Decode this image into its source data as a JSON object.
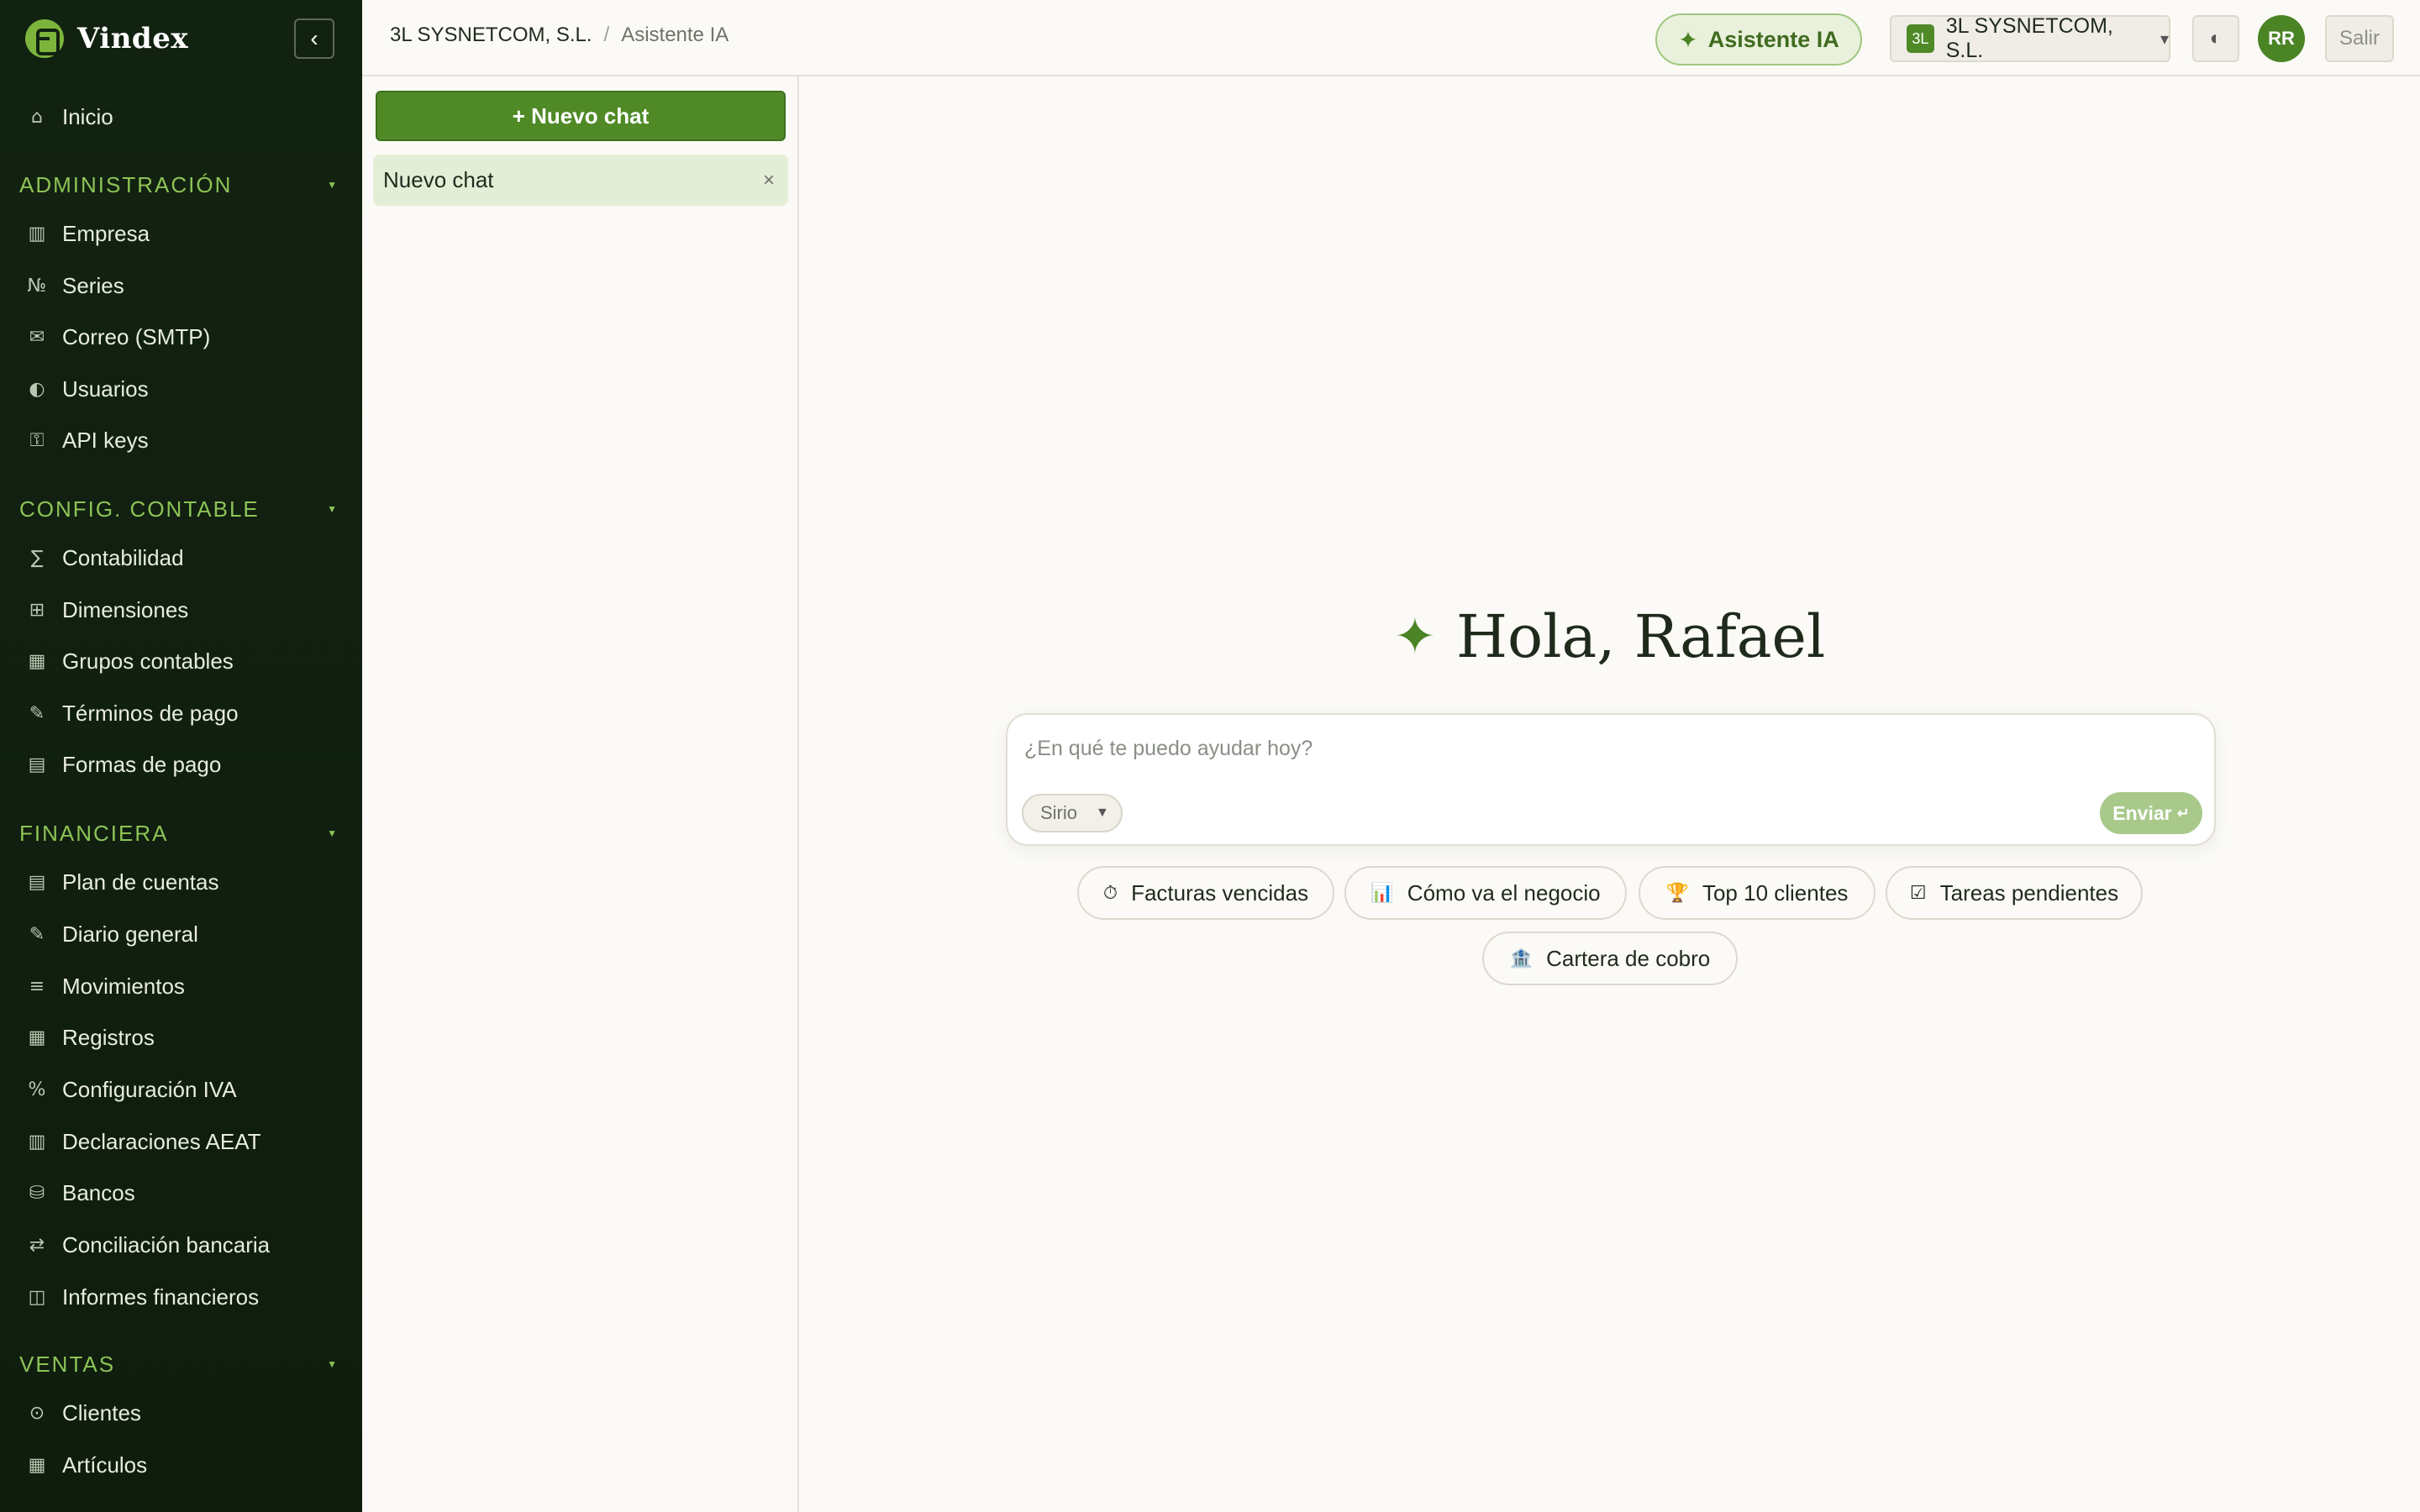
{
  "brand": {
    "name": "Vindex",
    "collapse_icon": "‹"
  },
  "sidebar": {
    "home": {
      "icon": "⌂",
      "label": "Inicio"
    },
    "sections": [
      {
        "title": "ADMINISTRACIÓN",
        "items": [
          {
            "icon": "▥",
            "label": "Empresa"
          },
          {
            "icon": "№",
            "label": "Series"
          },
          {
            "icon": "✉",
            "label": "Correo (SMTP)"
          },
          {
            "icon": "◐",
            "label": "Usuarios"
          },
          {
            "icon": "⚿",
            "label": "API keys"
          }
        ]
      },
      {
        "title": "CONFIG. CONTABLE",
        "items": [
          {
            "icon": "∑",
            "label": "Contabilidad"
          },
          {
            "icon": "⊞",
            "label": "Dimensiones"
          },
          {
            "icon": "▦",
            "label": "Grupos contables"
          },
          {
            "icon": "✎",
            "label": "Términos de pago"
          },
          {
            "icon": "▤",
            "label": "Formas de pago"
          }
        ]
      },
      {
        "title": "FINANCIERA",
        "items": [
          {
            "icon": "▤",
            "label": "Plan de cuentas"
          },
          {
            "icon": "✎",
            "label": "Diario general"
          },
          {
            "icon": "≡",
            "label": "Movimientos"
          },
          {
            "icon": "▦",
            "label": "Registros"
          },
          {
            "icon": "%",
            "label": "Configuración IVA"
          },
          {
            "icon": "▥",
            "label": "Declaraciones AEAT"
          },
          {
            "icon": "⛁",
            "label": "Bancos"
          },
          {
            "icon": "⇄",
            "label": "Conciliación bancaria"
          },
          {
            "icon": "◫",
            "label": "Informes financieros"
          }
        ]
      },
      {
        "title": "VENTAS",
        "items": [
          {
            "icon": "⊙",
            "label": "Clientes"
          },
          {
            "icon": "▦",
            "label": "Artículos"
          }
        ]
      }
    ]
  },
  "header": {
    "breadcrumb": [
      "3L SYSNETCOM, S.L.",
      "Asistente IA"
    ],
    "ai_button": "Asistente IA",
    "company": {
      "badge": "3L",
      "name": "3L SYSNETCOM, S.L."
    },
    "theme_icon": "◐",
    "avatar": "RR",
    "logout": "Salir"
  },
  "chats": {
    "new_button": "+ Nuevo chat",
    "items": [
      {
        "title": "Nuevo chat",
        "close": "×"
      }
    ]
  },
  "main": {
    "greeting": "Hola, Rafael",
    "spark_icon": "✦",
    "input_placeholder": "¿En qué te puedo ayudar hoy?",
    "model": "Sirio",
    "send": "Enviar",
    "send_icon": "↵",
    "suggestions": [
      {
        "icon": "⏱",
        "label": "Facturas vencidas"
      },
      {
        "icon": "📊",
        "label": "Cómo va el negocio"
      },
      {
        "icon": "🏆",
        "label": "Top 10 clientes"
      },
      {
        "icon": "☑",
        "label": "Tareas pendientes"
      },
      {
        "icon": "🏦",
        "label": "Cartera de cobro"
      }
    ]
  },
  "colors": {
    "sidebar_bg": "#122211",
    "accent": "#4f8a27",
    "section_title": "#8dc356",
    "page_bg": "#fbfaf6"
  }
}
